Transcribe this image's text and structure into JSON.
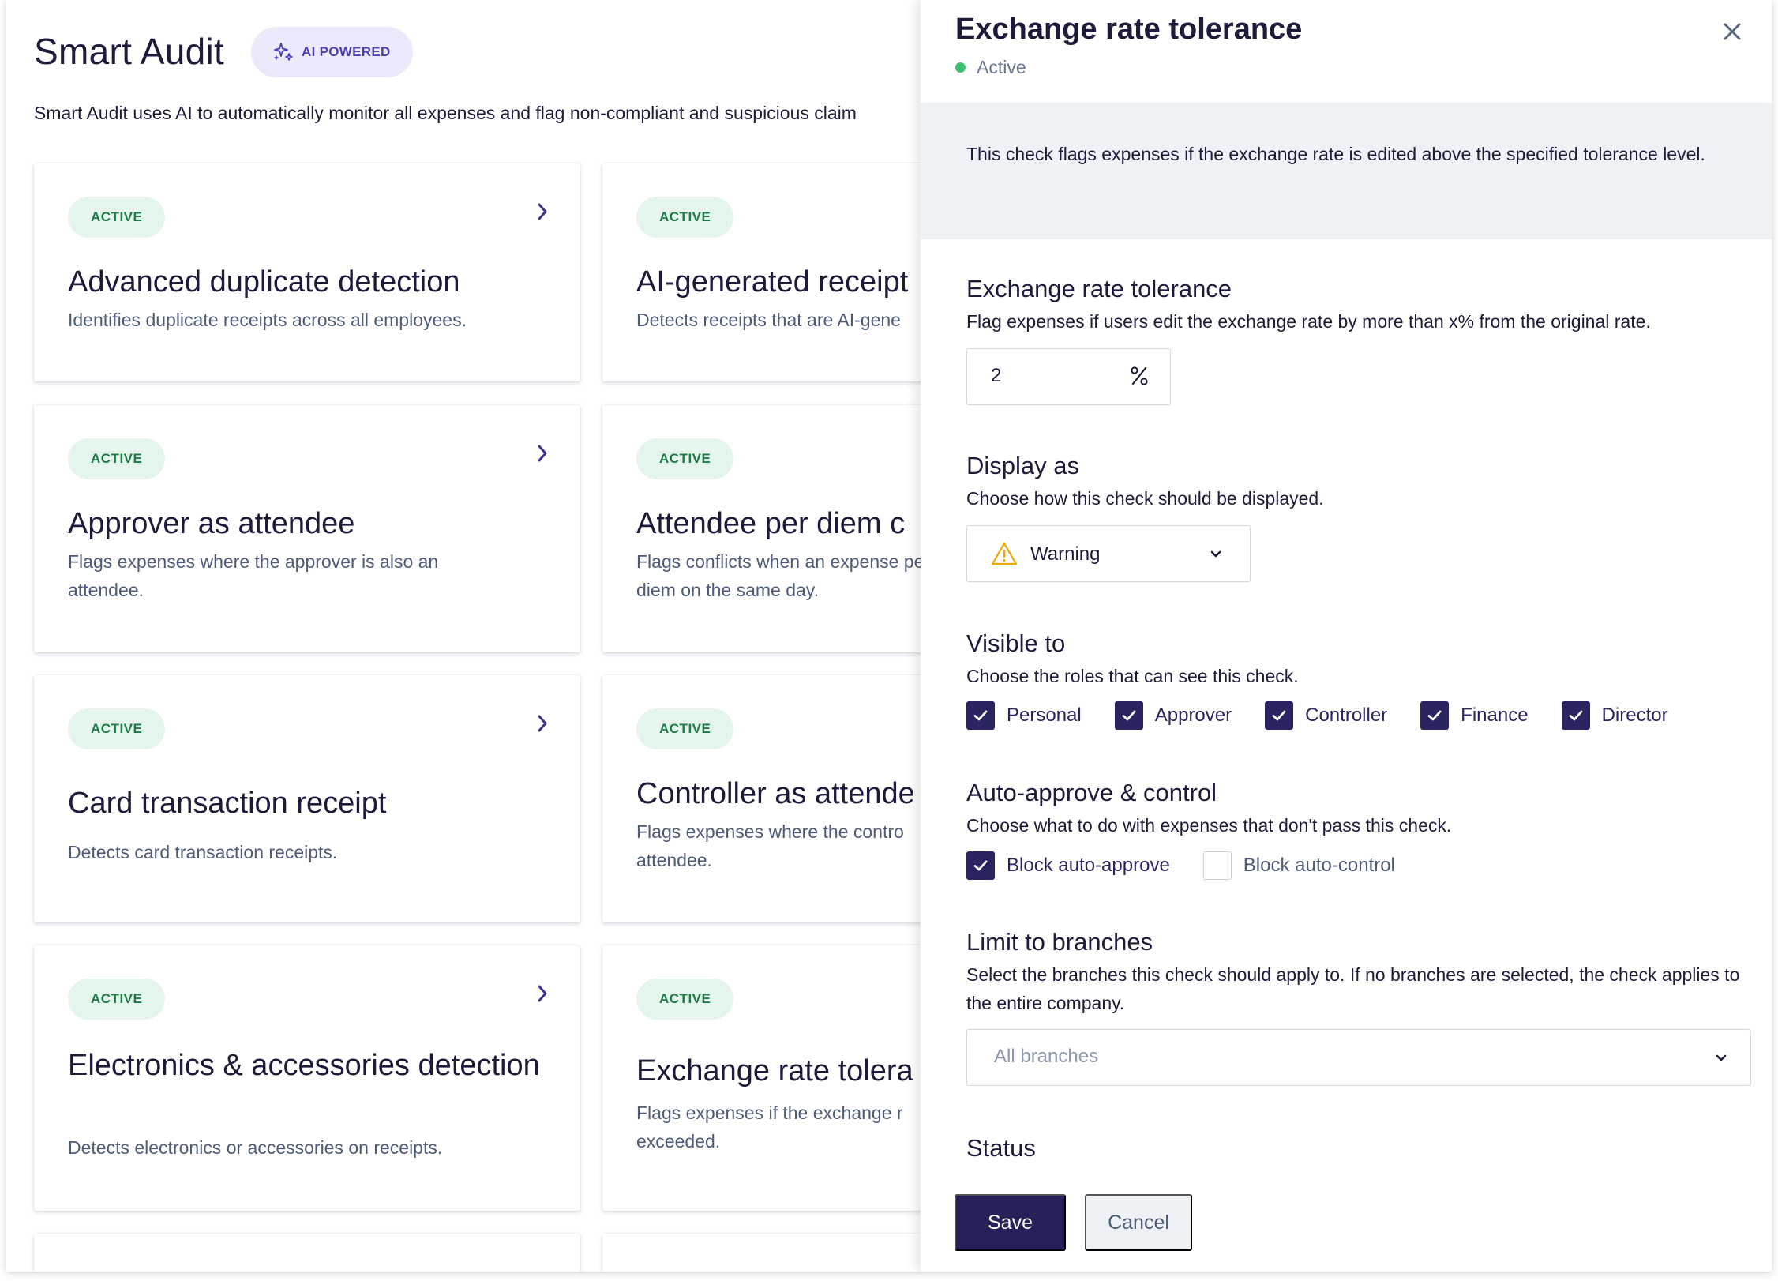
{
  "page": {
    "title": "Smart Audit",
    "ai_badge": "AI POWERED",
    "description": "Smart Audit uses AI to automatically monitor all expenses and flag non-compliant and suspicious claim"
  },
  "cards": [
    {
      "badge": "ACTIVE",
      "title": "Advanced duplicate detection",
      "desc": "Identifies duplicate receipts across all employees."
    },
    {
      "badge": "ACTIVE",
      "title": "AI-generated receipt",
      "desc": "Detects receipts that are AI-gene"
    },
    {
      "badge": "ACTIVE",
      "title": "Approver as attendee",
      "desc": "Flags expenses where the approver is also an attendee."
    },
    {
      "badge": "ACTIVE",
      "title": "Attendee per diem c",
      "desc": "Flags conflicts when an expense per diem on the same day."
    },
    {
      "badge": "ACTIVE",
      "title": "Card transaction receipt",
      "desc": "Detects card transaction receipts."
    },
    {
      "badge": "ACTIVE",
      "title": "Controller as attende",
      "desc": "Flags expenses where the contro attendee."
    },
    {
      "badge": "ACTIVE",
      "title": "Electronics & accessories detection",
      "desc": "Detects electronics or accessories on receipts."
    },
    {
      "badge": "ACTIVE",
      "title": "Exchange rate tolera",
      "desc": "Flags expenses if the exchange r exceeded."
    }
  ],
  "panel": {
    "title": "Exchange rate tolerance",
    "status": "Active",
    "info": "This check flags expenses if the exchange rate is edited above the specified tolerance level.",
    "tolerance": {
      "title": "Exchange rate tolerance",
      "desc": "Flag expenses if users edit the exchange rate by more than x% from the original rate.",
      "value": "2"
    },
    "display": {
      "title": "Display as",
      "desc": "Choose how this check should be displayed.",
      "selected": "Warning"
    },
    "visible": {
      "title": "Visible to",
      "desc": "Choose the roles that can see this check.",
      "roles": [
        {
          "label": "Personal",
          "checked": true
        },
        {
          "label": "Approver",
          "checked": true
        },
        {
          "label": "Controller",
          "checked": true
        },
        {
          "label": "Finance",
          "checked": true
        },
        {
          "label": "Director",
          "checked": true
        }
      ]
    },
    "auto": {
      "title": "Auto-approve & control",
      "desc": "Choose what to do with expenses that don't pass this check.",
      "options": [
        {
          "label": "Block auto-approve",
          "checked": true
        },
        {
          "label": "Block auto-control",
          "checked": false
        }
      ]
    },
    "branches": {
      "title": "Limit to branches",
      "desc": "Select the branches this check should apply to. If no branches are selected, the check applies to the entire company.",
      "placeholder": "All branches"
    },
    "status_section": {
      "title": "Status"
    },
    "save_label": "Save",
    "cancel_label": "Cancel"
  },
  "colors": {
    "primary": "#252159",
    "active_badge_bg": "#e4f6ec",
    "active_badge_text": "#1f7a45",
    "ai_badge_bg": "#ece9fb",
    "status_dot": "#3fbf72",
    "info_bg": "#eef2f7",
    "warning": "#f0a500"
  }
}
